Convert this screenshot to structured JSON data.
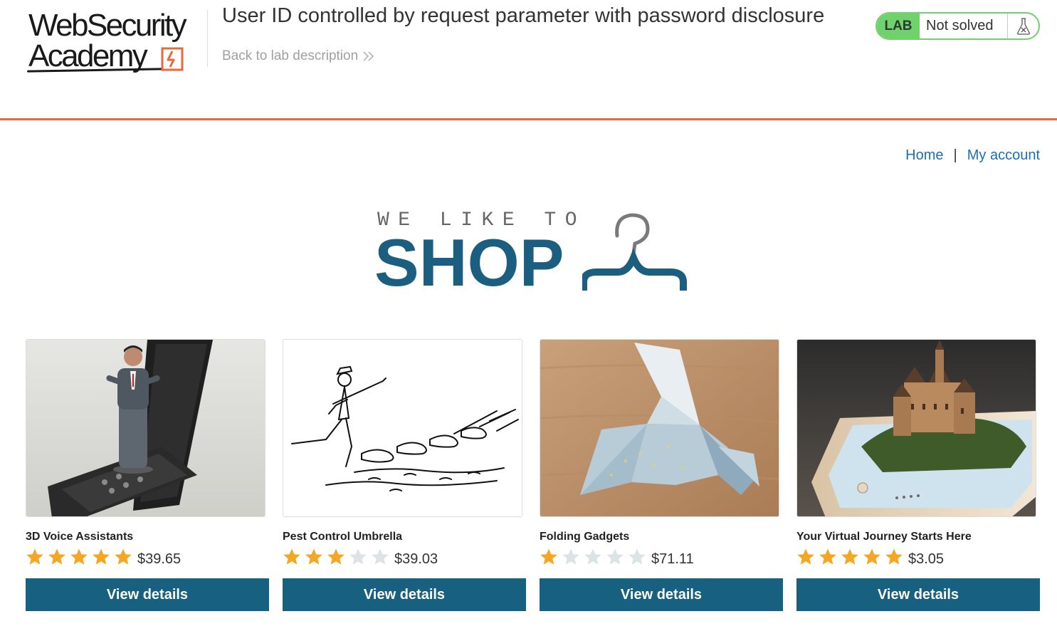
{
  "academy": {
    "logo_line1": "WebSecurity",
    "logo_line2": "Academy",
    "lab_title": "User ID controlled by request parameter with password disclosure",
    "back_link": "Back to lab description",
    "lab_badge": "LAB",
    "lab_status": "Not solved"
  },
  "nav": {
    "home": "Home",
    "separator": "|",
    "my_account": "My account"
  },
  "banner": {
    "tagline": "WE LIKE TO",
    "shop": "SHOP"
  },
  "colors": {
    "accent_orange": "#e8693e",
    "lab_green": "#70d16d",
    "brand_blue": "#1b5e80",
    "button_blue": "#17607f",
    "link_blue": "#1a70b5",
    "star_gold": "#f5a623",
    "star_empty": "#dde2e4"
  },
  "products": [
    {
      "name": "3D Voice Assistants",
      "rating": 5,
      "price": "$39.65",
      "button": "View details",
      "image_icon": "hologram-phone-image"
    },
    {
      "name": "Pest Control Umbrella",
      "rating": 3,
      "price": "$39.03",
      "button": "View details",
      "image_icon": "umbrella-sketch-image"
    },
    {
      "name": "Folding Gadgets",
      "rating": 1,
      "price": "$71.11",
      "button": "View details",
      "image_icon": "origami-bird-image"
    },
    {
      "name": "Your Virtual Journey Starts Here",
      "rating": 5,
      "price": "$3.05",
      "button": "View details",
      "image_icon": "castle-phone-image"
    }
  ]
}
